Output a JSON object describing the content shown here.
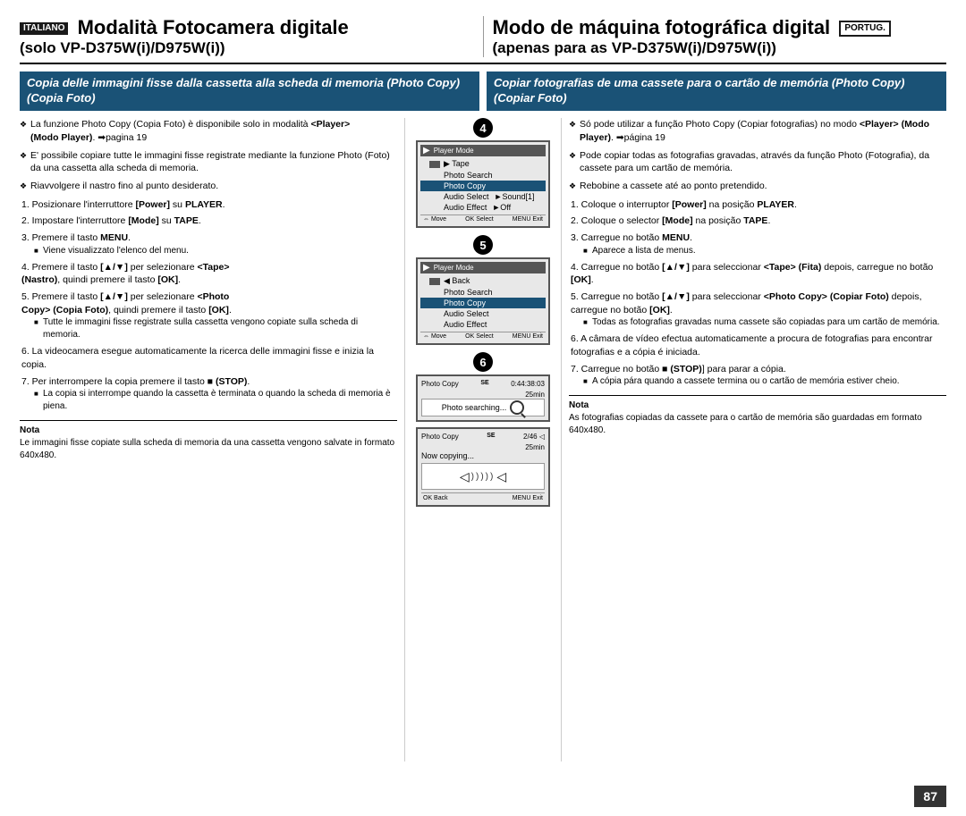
{
  "header": {
    "left_badge": "ITALIANO",
    "left_title": "Modalità Fotocamera digitale",
    "left_subtitle": "(solo VP-D375W(i)/D975W(i))",
    "right_title": "Modo de máquina fotográfica digital",
    "right_badge": "PORTUG.",
    "right_subtitle": "(apenas para as VP-D375W(i)/D975W(i))"
  },
  "subheader": {
    "left": "Copia delle immagini fisse dalla cassetta alla scheda di memoria (Photo Copy) (Copia Foto)",
    "right": "Copiar fotografias de uma cassete para o cartão de memória (Photo Copy) (Copiar Foto)"
  },
  "left_col": {
    "bullets": [
      "La funzione Photo Copy (Copia Foto) è disponibile solo in modalità <Player> (Modo Player). ➡pagina 19",
      "E' possibile copiare tutte le immagini fisse registrate mediante la funzione Photo (Foto) da una cassetta alla scheda di memoria.",
      "Riavvolgere il nastro fino al punto desiderato."
    ],
    "steps": [
      {
        "num": "1",
        "text": "Posizionare l'interruttore [Power] su PLAYER."
      },
      {
        "num": "2",
        "text": "Impostare l'interruttore [Mode] su TAPE."
      },
      {
        "num": "3",
        "text": "Premere il tasto MENU.",
        "sub": "■ Viene visualizzato l'elenco del menu."
      },
      {
        "num": "4",
        "text": "Premere il tasto [▲/▼] per selezionare <Tape> (Nastro), quindi premere il tasto [OK]."
      },
      {
        "num": "5",
        "text": "Premere il tasto [▲/▼] per selezionare <Photo Copy> (Copia Foto), quindi premere il tasto [OK].",
        "sub2": "■ Tutte le immagini fisse registrate sulla cassetta vengono copiate sulla scheda di memoria."
      },
      {
        "num": "6",
        "text": "La videocamera esegue automaticamente la ricerca delle immagini fisse e inizia la copia."
      },
      {
        "num": "7",
        "text": "Per interrompere la copia premere il tasto ■ (STOP).",
        "sub3": "■ La copia si interrompe quando la cassetta è terminata o quando la scheda di memoria è piena."
      }
    ],
    "nota_label": "Nota",
    "nota_text": "Le immagini fisse copiate sulla scheda di memoria da una cassetta vengono salvate in formato 640x480."
  },
  "right_col": {
    "bullets": [
      "Só pode utilizar a função Photo Copy (Copiar fotografias) no modo <Player> (Modo Player). ➡página 19",
      "Pode copiar todas as fotografias gravadas, através da função Photo (Fotografia), da cassete para um cartão de memória.",
      "Rebobine a cassete até ao ponto pretendido."
    ],
    "steps": [
      {
        "num": "1",
        "text": "Coloque o interruptor [Power] na posição PLAYER."
      },
      {
        "num": "2",
        "text": "Coloque o selector [Mode] na posição TAPE."
      },
      {
        "num": "3",
        "text": "Carregue no botão MENU.",
        "sub": "■ Aparece a lista de menus."
      },
      {
        "num": "4",
        "text": "Carregue no botão [▲/▼] para seleccionar <Tape> (Fita) depois, carregue no botão [OK]."
      },
      {
        "num": "5",
        "text": "Carregue no botão [▲/▼] para seleccionar <Photo Copy> (Copiar Foto) depois, carregue no botão [OK].",
        "sub2": "■ Todas as fotografias gravadas numa cassete são copiadas para um cartão de memória."
      },
      {
        "num": "6",
        "text": "A câmara de vídeo efectua automaticamente a procura de fotografias para encontrar fotografias e a cópia é iniciada."
      },
      {
        "num": "7",
        "text": "Carregue no botão ■ (STOP)] para parar a cópia.",
        "sub3": "■ A cópia pára quando a cassete termina ou o cartão de memória estiver cheio."
      }
    ],
    "nota_label": "Nota",
    "nota_text": "As fotografias copiadas da cassete para o cartão de memória são guardadas em formato 640x480."
  },
  "screens": {
    "screen4": {
      "header_icon": "▶",
      "header_text": "Player Mode",
      "items": [
        {
          "label": "▶ Tape",
          "icon": "tape",
          "selected": false
        },
        {
          "label": "Photo Search",
          "selected": false
        },
        {
          "label": "Photo Copy",
          "selected": true
        },
        {
          "label": "Audio Select",
          "sub": "►Sound[1]",
          "selected": false
        },
        {
          "label": "Audio Effect",
          "sub": "►Off",
          "selected": false
        }
      ],
      "footer": "⇔ Move   OK Select   MENU Exit"
    },
    "screen5": {
      "header_icon": "▶",
      "header_text": "Player Mode",
      "back": "◀ Back",
      "items": [
        {
          "label": "Photo Search",
          "selected": false
        },
        {
          "label": "Photo Copy",
          "selected": true
        },
        {
          "label": "Audio Select",
          "selected": false
        },
        {
          "label": "Audio Effect",
          "selected": false
        }
      ],
      "footer": "⇔ Move   OK Select   MENU Exit"
    },
    "screen6a": {
      "label_left": "Photo Copy",
      "time": "0:44:38:03",
      "se": "SE",
      "time_remain": "25min",
      "searching_text": "Photo searching..."
    },
    "screen6b": {
      "label_left": "Photo Copy",
      "counter": "2/46",
      "se": "SE",
      "time_remain": "25min",
      "copying_text": "Now copying..."
    }
  },
  "page_number": "87"
}
